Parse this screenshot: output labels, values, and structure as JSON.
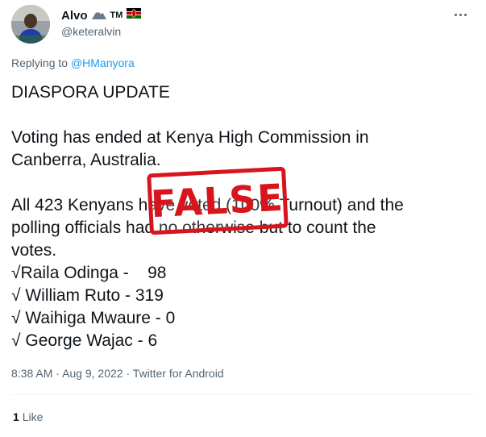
{
  "author": {
    "name": "Alvo",
    "tm": "TM",
    "handle": "@keteralvin"
  },
  "reply": {
    "prefix": "Replying to",
    "to": "@HManyora"
  },
  "tweet": {
    "lines": [
      "DIASPORA UPDATE",
      "",
      "Voting has ended at Kenya High Commission in",
      "Canberra, Australia.",
      "",
      "All 423 Kenyans have voted (100% Turnout) and the",
      "polling officials had no otherwise but to count the",
      "votes.",
      "√Raila Odinga -    98",
      "√ William Ruto - 319",
      "√ Waihiga Mwaure - 0",
      "√ George Wajac - 6"
    ]
  },
  "stamp": {
    "text": "FALSE",
    "color": "#d6151d"
  },
  "meta": {
    "time": "8:38 AM",
    "date": "Aug 9, 2022",
    "separator": "·",
    "source": "Twitter for Android"
  },
  "stats": {
    "likes_count": "1",
    "likes_label": "Like"
  },
  "icons": {
    "avatar": "profile-photo",
    "mountain": "mountain-emoji-icon",
    "flag": "kenya-flag-icon",
    "more": "more-options-icon"
  }
}
